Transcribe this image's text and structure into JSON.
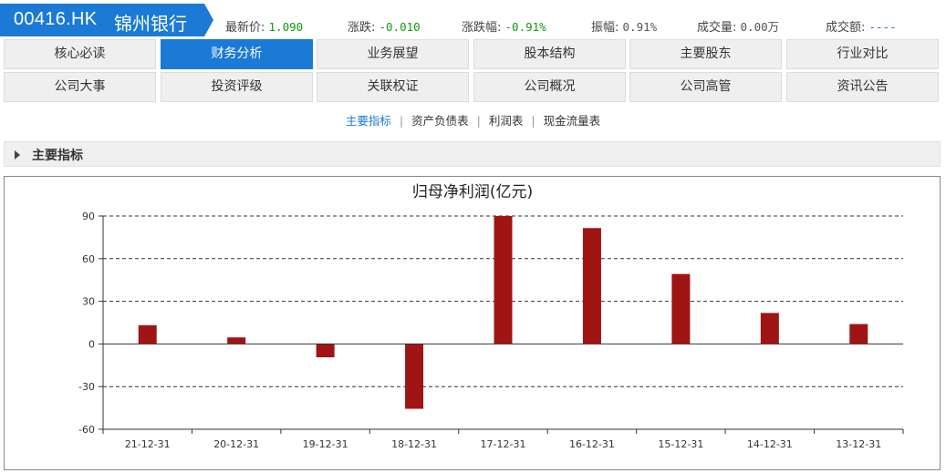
{
  "header": {
    "ticker_code": "00416.HK",
    "ticker_name": "锦州银行",
    "brand_color": "#1a7ad6",
    "quotes": [
      {
        "label": "最新价:",
        "value": "1.090",
        "tone": "green"
      },
      {
        "label": "涨跌:",
        "value": "-0.010",
        "tone": "green"
      },
      {
        "label": "涨跌幅:",
        "value": "-0.91%",
        "tone": "green"
      },
      {
        "label": "振幅:",
        "value": "0.91%",
        "tone": "gray"
      },
      {
        "label": "成交量:",
        "value": "0.00万",
        "tone": "gray"
      },
      {
        "label": "成交额:",
        "value": "----",
        "tone": "blue"
      }
    ]
  },
  "tabs": {
    "row1": [
      "核心必读",
      "财务分析",
      "业务展望",
      "股本结构",
      "主要股东",
      "行业对比"
    ],
    "row2": [
      "公司大事",
      "投资评级",
      "关联权证",
      "公司概况",
      "公司高管",
      "资讯公告"
    ],
    "active": "财务分析"
  },
  "subnav": {
    "items": [
      "主要指标",
      "资产负债表",
      "利润表",
      "现金流量表"
    ],
    "active": "主要指标"
  },
  "section": {
    "title": "主要指标"
  },
  "chart_data": {
    "type": "bar",
    "title": "归母净利润(亿元)",
    "categories": [
      "21-12-31",
      "20-12-31",
      "19-12-31",
      "18-12-31",
      "17-12-31",
      "16-12-31",
      "15-12-31",
      "14-12-31",
      "13-12-31"
    ],
    "values": [
      13.2,
      4.6,
      -9.4,
      -45.6,
      90.0,
      81.5,
      49.2,
      21.8,
      14.0
    ],
    "ylim": [
      -60,
      90
    ],
    "yticks": [
      "90",
      "60",
      "30",
      "0",
      "-30",
      "-60"
    ],
    "grid": true,
    "bar_color": "#a01414"
  }
}
